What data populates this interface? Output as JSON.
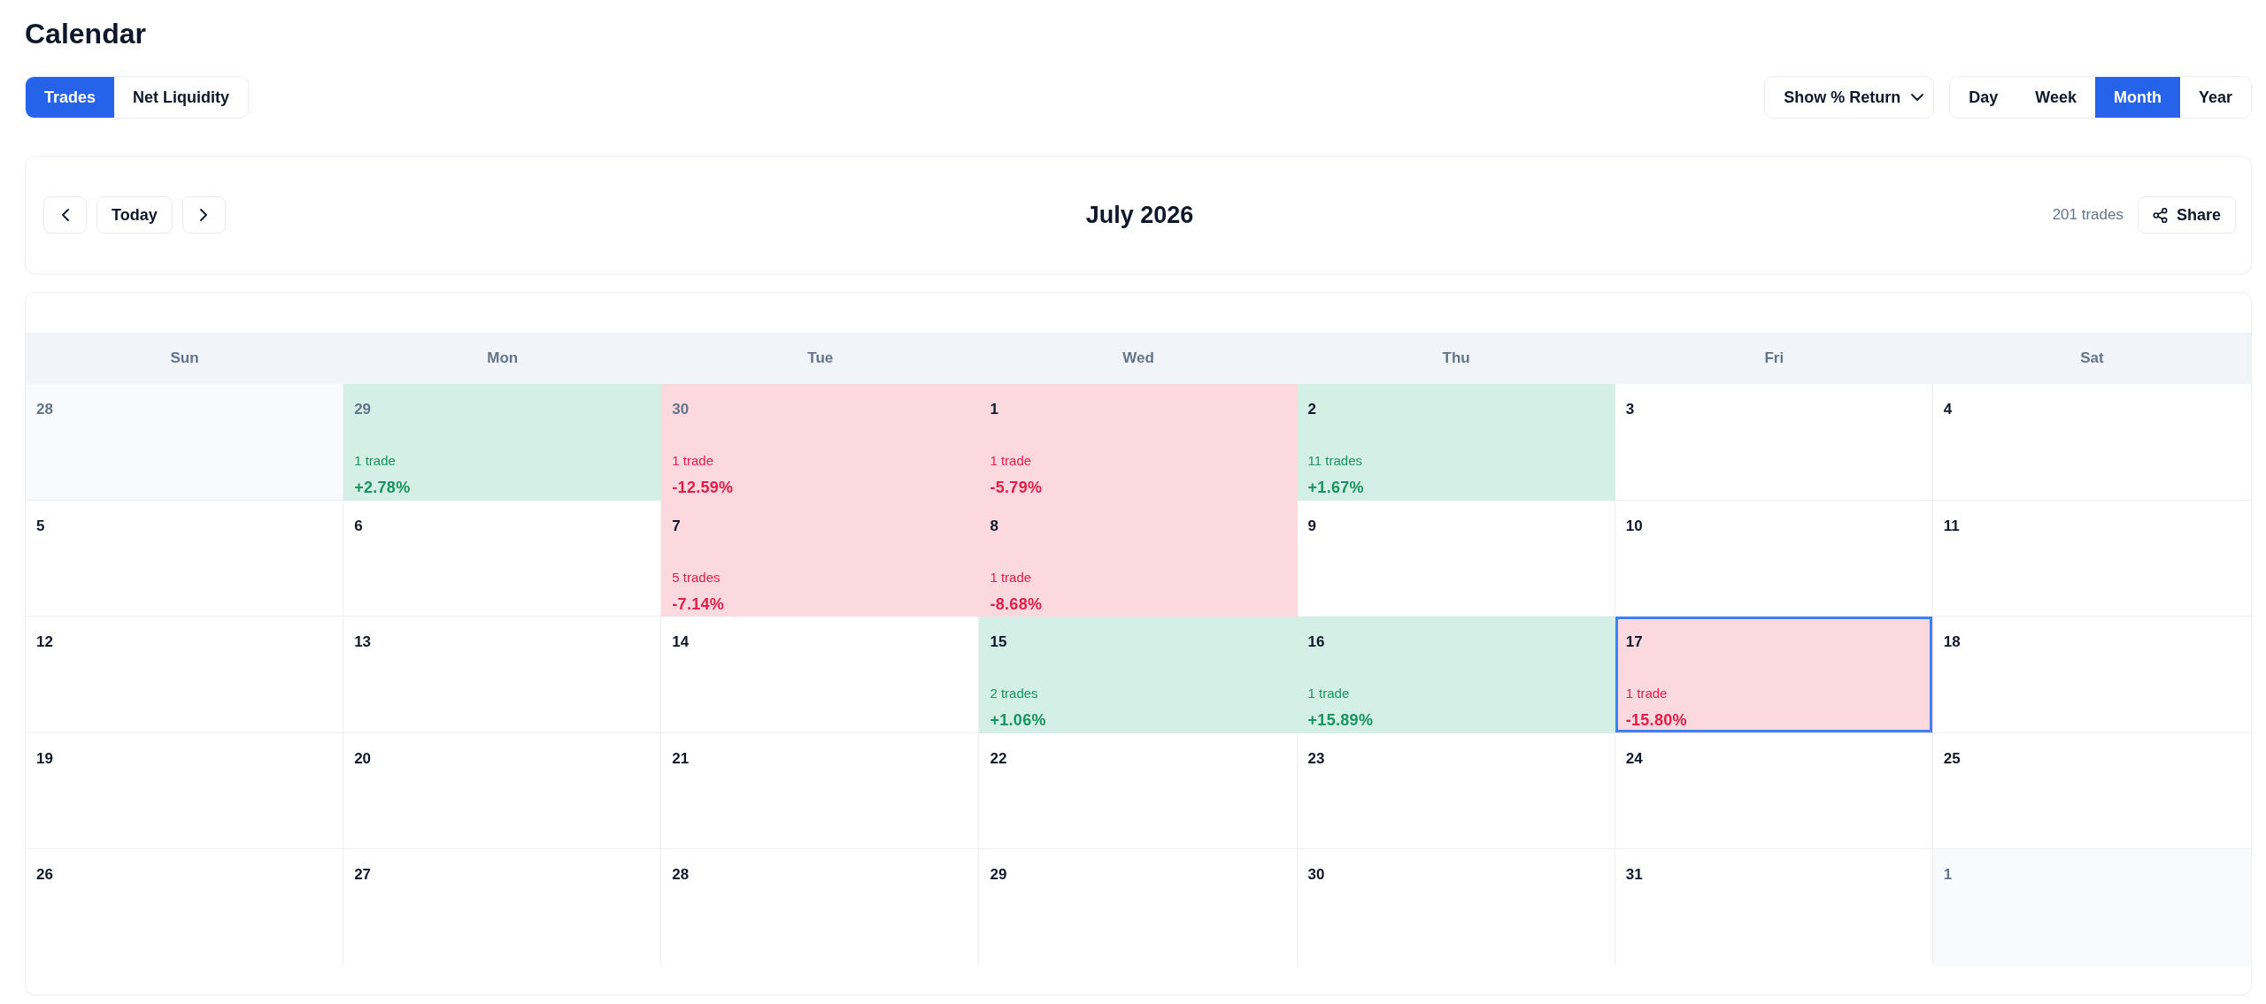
{
  "page": {
    "title": "Calendar"
  },
  "tabs": [
    {
      "label": "Trades",
      "selected": true
    },
    {
      "label": "Net Liquidity",
      "selected": false
    }
  ],
  "return_mode": {
    "value": "Show % Return"
  },
  "views": [
    {
      "label": "Day",
      "selected": false
    },
    {
      "label": "Week",
      "selected": false
    },
    {
      "label": "Month",
      "selected": true
    },
    {
      "label": "Year",
      "selected": false
    }
  ],
  "navigation": {
    "today": "Today",
    "month": "July 2026",
    "trade_count": "201 trades",
    "share": "Share"
  },
  "weekdays": [
    "Sun",
    "Mon",
    "Tue",
    "Wed",
    "Thu",
    "Fri",
    "Sat"
  ],
  "weeks": [
    {
      "days": [
        {
          "day": "28",
          "in_month": false,
          "kind": "plain",
          "selected": false
        },
        {
          "day": "29",
          "in_month": false,
          "kind": "gain",
          "selected": false,
          "trades": "1 trade",
          "return": "+2.78%"
        },
        {
          "day": "30",
          "in_month": false,
          "kind": "loss",
          "selected": false,
          "trades": "1 trade",
          "return": "-12.59%"
        },
        {
          "day": "1",
          "in_month": true,
          "kind": "loss",
          "selected": false,
          "trades": "1 trade",
          "return": "-5.79%"
        },
        {
          "day": "2",
          "in_month": true,
          "kind": "gain",
          "selected": false,
          "trades": "11 trades",
          "return": "+1.67%"
        },
        {
          "day": "3",
          "in_month": true,
          "kind": "plain",
          "selected": false
        },
        {
          "day": "4",
          "in_month": true,
          "kind": "plain",
          "selected": false
        }
      ]
    },
    {
      "days": [
        {
          "day": "5",
          "in_month": true,
          "kind": "plain",
          "selected": false
        },
        {
          "day": "6",
          "in_month": true,
          "kind": "plain",
          "selected": false
        },
        {
          "day": "7",
          "in_month": true,
          "kind": "loss",
          "selected": false,
          "trades": "5 trades",
          "return": "-7.14%"
        },
        {
          "day": "8",
          "in_month": true,
          "kind": "loss",
          "selected": false,
          "trades": "1 trade",
          "return": "-8.68%"
        },
        {
          "day": "9",
          "in_month": true,
          "kind": "plain",
          "selected": false
        },
        {
          "day": "10",
          "in_month": true,
          "kind": "plain",
          "selected": false
        },
        {
          "day": "11",
          "in_month": true,
          "kind": "plain",
          "selected": false
        }
      ]
    },
    {
      "days": [
        {
          "day": "12",
          "in_month": true,
          "kind": "plain",
          "selected": false
        },
        {
          "day": "13",
          "in_month": true,
          "kind": "plain",
          "selected": false
        },
        {
          "day": "14",
          "in_month": true,
          "kind": "plain",
          "selected": false
        },
        {
          "day": "15",
          "in_month": true,
          "kind": "gain",
          "selected": false,
          "trades": "2 trades",
          "return": "+1.06%"
        },
        {
          "day": "16",
          "in_month": true,
          "kind": "gain",
          "selected": false,
          "trades": "1 trade",
          "return": "+15.89%"
        },
        {
          "day": "17",
          "in_month": true,
          "kind": "loss",
          "selected": true,
          "trades": "1 trade",
          "return": "-15.80%"
        },
        {
          "day": "18",
          "in_month": true,
          "kind": "plain",
          "selected": false
        }
      ]
    },
    {
      "days": [
        {
          "day": "19",
          "in_month": true,
          "kind": "plain",
          "selected": false
        },
        {
          "day": "20",
          "in_month": true,
          "kind": "plain",
          "selected": false
        },
        {
          "day": "21",
          "in_month": true,
          "kind": "plain",
          "selected": false
        },
        {
          "day": "22",
          "in_month": true,
          "kind": "plain",
          "selected": false
        },
        {
          "day": "23",
          "in_month": true,
          "kind": "plain",
          "selected": false
        },
        {
          "day": "24",
          "in_month": true,
          "kind": "plain",
          "selected": false
        },
        {
          "day": "25",
          "in_month": true,
          "kind": "plain",
          "selected": false
        }
      ]
    },
    {
      "days": [
        {
          "day": "26",
          "in_month": true,
          "kind": "plain",
          "selected": false
        },
        {
          "day": "27",
          "in_month": true,
          "kind": "plain",
          "selected": false
        },
        {
          "day": "28",
          "in_month": true,
          "kind": "plain",
          "selected": false
        },
        {
          "day": "29",
          "in_month": true,
          "kind": "plain",
          "selected": false
        },
        {
          "day": "30",
          "in_month": true,
          "kind": "plain",
          "selected": false
        },
        {
          "day": "31",
          "in_month": true,
          "kind": "plain",
          "selected": false
        },
        {
          "day": "1",
          "in_month": false,
          "kind": "plain",
          "selected": false
        }
      ]
    }
  ]
}
